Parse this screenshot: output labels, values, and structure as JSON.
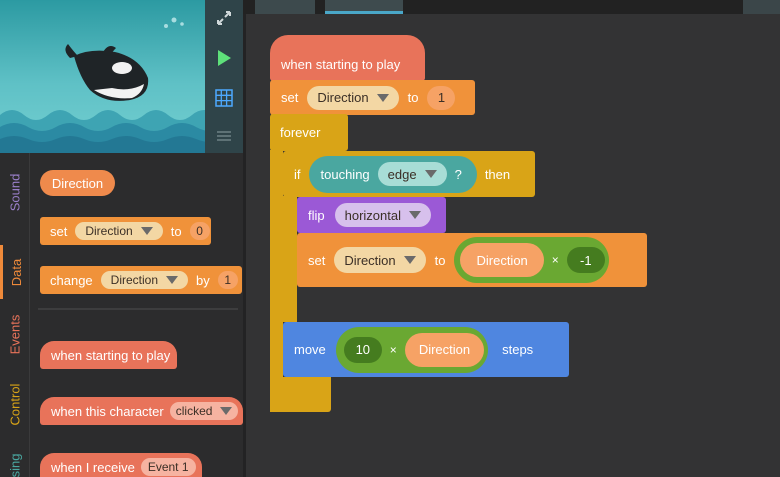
{
  "stage_tools": {
    "fullscreen_icon": "expand-arrows-icon",
    "play_icon": "play-triangle-icon",
    "grid_icon": "grid-icon",
    "menu_icon": "menu-lines-icon"
  },
  "categories": [
    {
      "label": "Sound",
      "color": "#9a7fc9"
    },
    {
      "label": "Data",
      "color": "#ef8a3a"
    },
    {
      "label": "Events",
      "color": "#e8735a"
    },
    {
      "label": "Control",
      "color": "#d9a417"
    },
    {
      "label": "sing",
      "color": "#4aa7a0"
    }
  ],
  "palette": {
    "variable_label": "Direction",
    "set_block": {
      "keyword": "set",
      "variable": "Direction",
      "to": "to",
      "value": "0"
    },
    "change_block": {
      "keyword": "change",
      "variable": "Direction",
      "by": "by",
      "value": "1"
    },
    "when_starting": "when starting to play",
    "when_clicked": {
      "text": "when this character",
      "option": "clicked"
    },
    "when_receive": {
      "text": "when I receive",
      "option": "Event 1"
    }
  },
  "script": {
    "hat": "when starting to play",
    "set1": {
      "keyword": "set",
      "variable": "Direction",
      "to": "to",
      "value": "1"
    },
    "forever": "forever",
    "if_block": {
      "if": "if",
      "touching": "touching",
      "target": "edge",
      "q": "?",
      "then": "then"
    },
    "flip": {
      "keyword": "flip",
      "option": "horizontal"
    },
    "set2": {
      "keyword": "set",
      "variable": "Direction",
      "to": "to",
      "op_var": "Direction",
      "op": "×",
      "op_value": "-1"
    },
    "move": {
      "keyword": "move",
      "value": "10",
      "op": "×",
      "op_var": "Direction",
      "steps": "steps"
    }
  },
  "colors": {
    "data": "#ef8a4c",
    "events": "#e8735a",
    "control": "#d9a417",
    "sensing": "#4aa7a0",
    "looks": "#9b59d6",
    "motion": "#4f86e0",
    "operators": "#6aa832"
  }
}
